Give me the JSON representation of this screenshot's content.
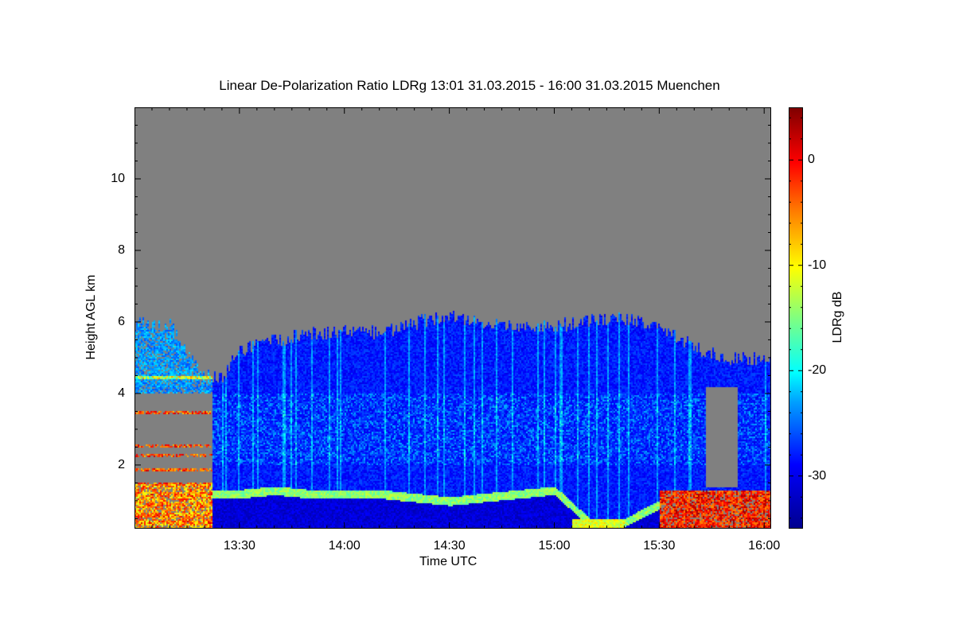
{
  "chart_data": {
    "type": "heatmap",
    "title": "Linear De-Polarization Ratio LDRg   13:01 31.03.2015 - 16:00 31.03.2015 Muenchen",
    "xlabel": "Time UTC",
    "ylabel": "Height AGL km",
    "colorbar_label": "LDRg dB",
    "xlim_minutes_after_1300": [
      0,
      182
    ],
    "ylim": [
      0.22,
      12
    ],
    "x_ticks": [
      {
        "label": "13:30",
        "min": 30
      },
      {
        "label": "14:00",
        "min": 60
      },
      {
        "label": "14:30",
        "min": 90
      },
      {
        "label": "15:00",
        "min": 120
      },
      {
        "label": "15:30",
        "min": 150
      },
      {
        "label": "16:00",
        "min": 180
      }
    ],
    "y_ticks": [
      {
        "label": "2",
        "v": 2
      },
      {
        "label": "4",
        "v": 4
      },
      {
        "label": "6",
        "v": 6
      },
      {
        "label": "8",
        "v": 8
      },
      {
        "label": "10",
        "v": 10
      }
    ],
    "colorbar_range": [
      -35,
      5
    ],
    "colorbar_ticks": [
      {
        "label": "0",
        "v": 0
      },
      {
        "label": "-10",
        "v": -10
      },
      {
        "label": "-20",
        "v": -20
      },
      {
        "label": "-30",
        "v": -30
      }
    ],
    "no_data_color": "#808080",
    "profile_minutes": [
      0,
      10,
      20,
      25,
      30,
      40,
      50,
      60,
      70,
      80,
      90,
      100,
      110,
      120,
      130,
      140,
      150,
      160,
      170,
      182
    ],
    "cloud_top_km": [
      6.0,
      5.9,
      4.5,
      4.5,
      5.2,
      5.5,
      5.7,
      5.8,
      5.7,
      6.0,
      6.2,
      6.0,
      5.9,
      5.9,
      6.1,
      6.1,
      5.9,
      5.3,
      5.0,
      5.0
    ],
    "boundary_layer_km": [
      1.2,
      1.2,
      1.2,
      1.2,
      1.2,
      1.3,
      1.2,
      1.2,
      1.2,
      1.1,
      1.0,
      1.1,
      1.2,
      1.3,
      0.4,
      0.4,
      0.9,
      0.9,
      0.9,
      0.9
    ],
    "typical_cloud_ldr_db": -30,
    "boundary_layer_ldr_db": -15,
    "low_level_aerosol_ldr_db": -5
  }
}
